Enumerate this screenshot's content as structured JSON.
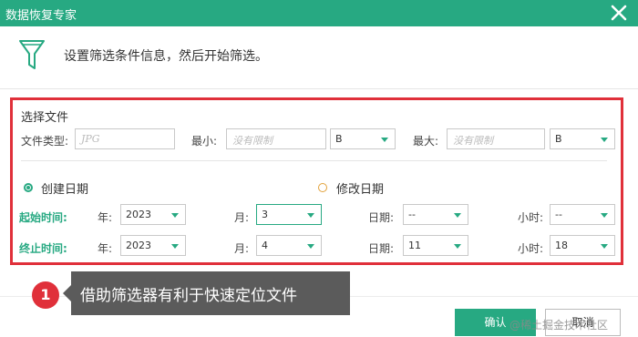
{
  "window": {
    "title": "数据恢复专家"
  },
  "header": {
    "hint": "设置筛选条件信息，然后开始筛选。"
  },
  "filter": {
    "section_title": "选择文件",
    "file_type_label": "文件类型:",
    "file_type_placeholder": "JPG",
    "min_label": "最小:",
    "min_placeholder": "没有限制",
    "min_unit": "B",
    "max_label": "最大:",
    "max_placeholder": "没有限制",
    "max_unit": "B",
    "create_date_label": "创建日期",
    "modify_date_label": "修改日期",
    "start": {
      "label": "起始时间:",
      "year_label": "年:",
      "year": "2023",
      "month_label": "月:",
      "month": "3",
      "day_label": "日期:",
      "day": "--",
      "hour_label": "小时:",
      "hour": "--"
    },
    "end": {
      "label": "终止时间:",
      "year_label": "年:",
      "year": "2023",
      "month_label": "月:",
      "month": "4",
      "day_label": "日期:",
      "day": "11",
      "hour_label": "小时:",
      "hour": "18"
    }
  },
  "annotation": {
    "step": "1",
    "text": "借助筛选器有利于快速定位文件"
  },
  "footer": {
    "ok_label": "确认",
    "cancel_label": "取消"
  },
  "watermark": "@稀土掘金技术社区",
  "colors": {
    "accent": "#27a982",
    "highlight": "#e0303a"
  },
  "icons": {
    "close": "close-icon",
    "funnel": "funnel-icon"
  }
}
